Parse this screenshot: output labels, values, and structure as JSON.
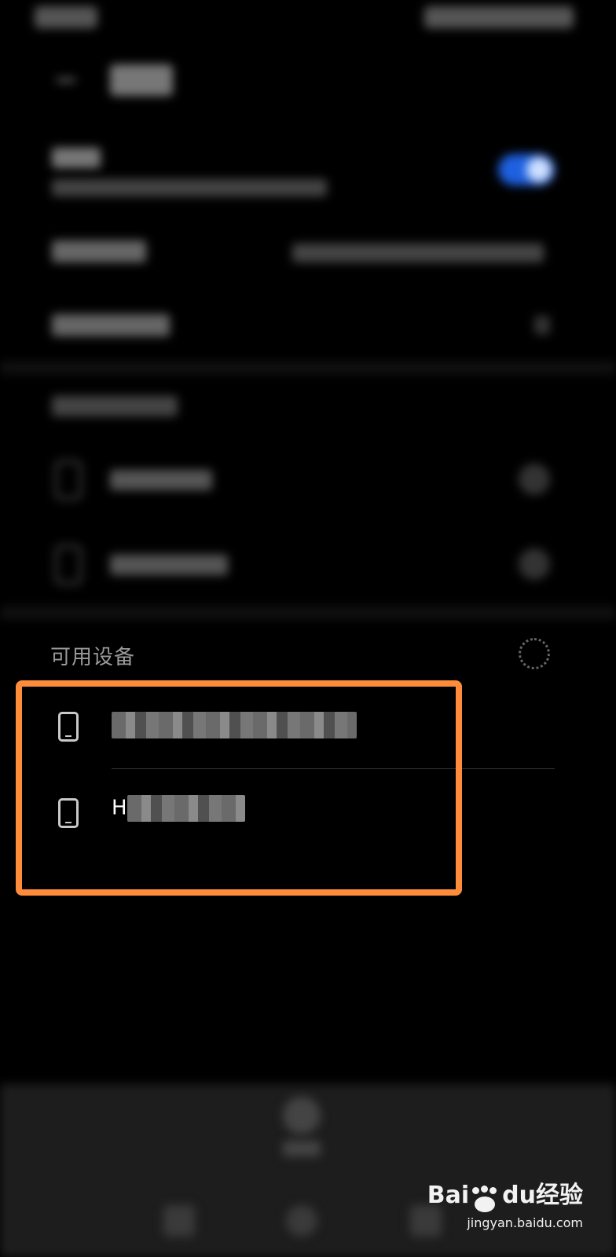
{
  "available_devices": {
    "title": "可用设备",
    "items": [
      {
        "name": ""
      },
      {
        "name_prefix": "H"
      }
    ]
  },
  "watermark": {
    "brand_left": "Bai",
    "brand_mid": "du",
    "brand_right": "经验",
    "url": "jingyan.baidu.com"
  },
  "colors": {
    "highlight": "#ff8c3a",
    "toggle_on": "#1e60e0",
    "background": "#000000"
  }
}
